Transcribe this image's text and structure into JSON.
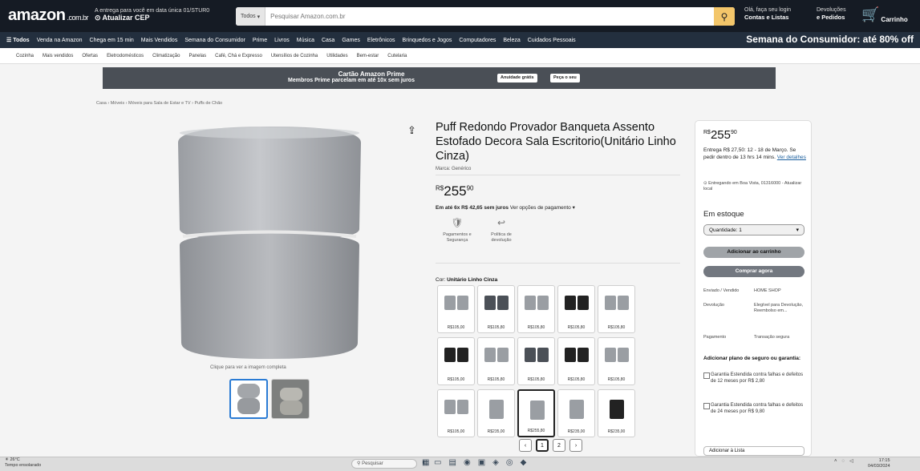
{
  "header": {
    "logo": "amazon",
    "logo_suffix": ".com.br",
    "location_line1": "A entrega para você em data única 01/STUR0",
    "location_line2": "Atualizar CEP",
    "search_category": "Todos",
    "search_placeholder": "Pesquisar Amazon.com.br",
    "account_line1": "Olá, faça seu login",
    "account_line2": "Contas e Listas",
    "orders_line1": "Devoluções",
    "orders_line2": "e Pedidos",
    "cart_label": "Carrinho"
  },
  "nav": {
    "items": [
      "☰ Todos",
      "Venda na Amazon",
      "Chega em 15 min",
      "Mais Vendidos",
      "Semana do Consumidor",
      "Prime",
      "Livros",
      "Música",
      "Casa",
      "Games",
      "Eletrônicos",
      "Brinquedos e Jogos",
      "Computadores",
      "Beleza",
      "Cuidados Pessoais"
    ],
    "promo": "Semana do Consumidor: até 80% off"
  },
  "subnav": [
    "Cozinha",
    "Mais vendidos",
    "Ofertas",
    "Eletrodomésticos",
    "Climatização",
    "Panelas",
    "Café, Chá e Expresso",
    "Utensílios de Cozinha",
    "Utilidades",
    "Bem-estar",
    "Cutelaria",
    "Tudo em Casa"
  ],
  "banner": {
    "line1": "Cartão Amazon Prime",
    "line2": "Membros Prime parcelam em até 10x sem juros",
    "btn1": "Anuidade grátis",
    "btn2": "Peça o seu"
  },
  "breadcrumb": "Casa › Móveis › Móveis para Sala de Estar e TV › Puffs de Chão",
  "gallery": {
    "zoom_hint": "Clique para ver a imagem completa"
  },
  "product": {
    "title": "Puff Redondo Provador Banqueta Assento Estofado Decora Sala Escritorio(Unitário Linho Cinza)",
    "brand": "Marca: Genérico",
    "price_whole": "255",
    "price_cents": "90",
    "currency": "R$",
    "installment_bold": "Em até 6x R$ 42,65 sem juros",
    "installment_rest": " Ver opções de pagamento",
    "features": [
      {
        "icon": "🛡",
        "label": "Pagamentos e Segurança"
      },
      {
        "icon": "↩",
        "label": "Política de devolução"
      }
    ],
    "color_label": "Cor:",
    "color_value": "Unitário Linho Cinza",
    "swatches": [
      "R$105,00",
      "R$105,80",
      "R$105,80",
      "R$105,80",
      "R$105,80",
      "R$105,00",
      "R$105,80",
      "R$105,80",
      "R$105,80",
      "R$105,80",
      "R$105,00",
      "R$235,00",
      "R$255,80",
      "R$235,00",
      "R$235,00"
    ],
    "pages": [
      "‹",
      "1",
      "2",
      "›"
    ]
  },
  "buybox": {
    "price_whole": "255",
    "price_cents": "90",
    "currency": "R$",
    "delivery": "Entrega R$ 27,50: 12 - 18 de Março. Se pedir dentro de 13 hrs 14 mins.",
    "details_link": "Ver detalhes",
    "location": "Entregando em Boa Vista, 01316000 - Atualizar local",
    "stock": "Em estoque",
    "quantity": "Quantidade: 1",
    "add_to_cart": "Adicionar ao carrinho",
    "buy_now": "Comprar agora",
    "ship_label": "Enviado / Vendido",
    "ship_value": "HOME SHOP",
    "return_label": "Devolução",
    "return_value": "Elegível para Devolução, Reembolso em...",
    "payment_label": "Pagamento",
    "payment_value": "Transação segura",
    "insurance_title": "Adicionar plano de seguro ou garantia:",
    "insurance_1": "Garantia Estendida contra falhas e defeitos de 12 meses por R$ 2,80",
    "insurance_2": "Garantia Estendida contra falhas e defeitos de 24 meses por R$ 9,80",
    "add_list": "Adicionar à Lista"
  },
  "taskbar": {
    "weather_temp": "26°C",
    "weather_desc": "Tempo ensolarado",
    "search": "Pesquisar",
    "time": "17:15",
    "date": "04/03/2024"
  }
}
